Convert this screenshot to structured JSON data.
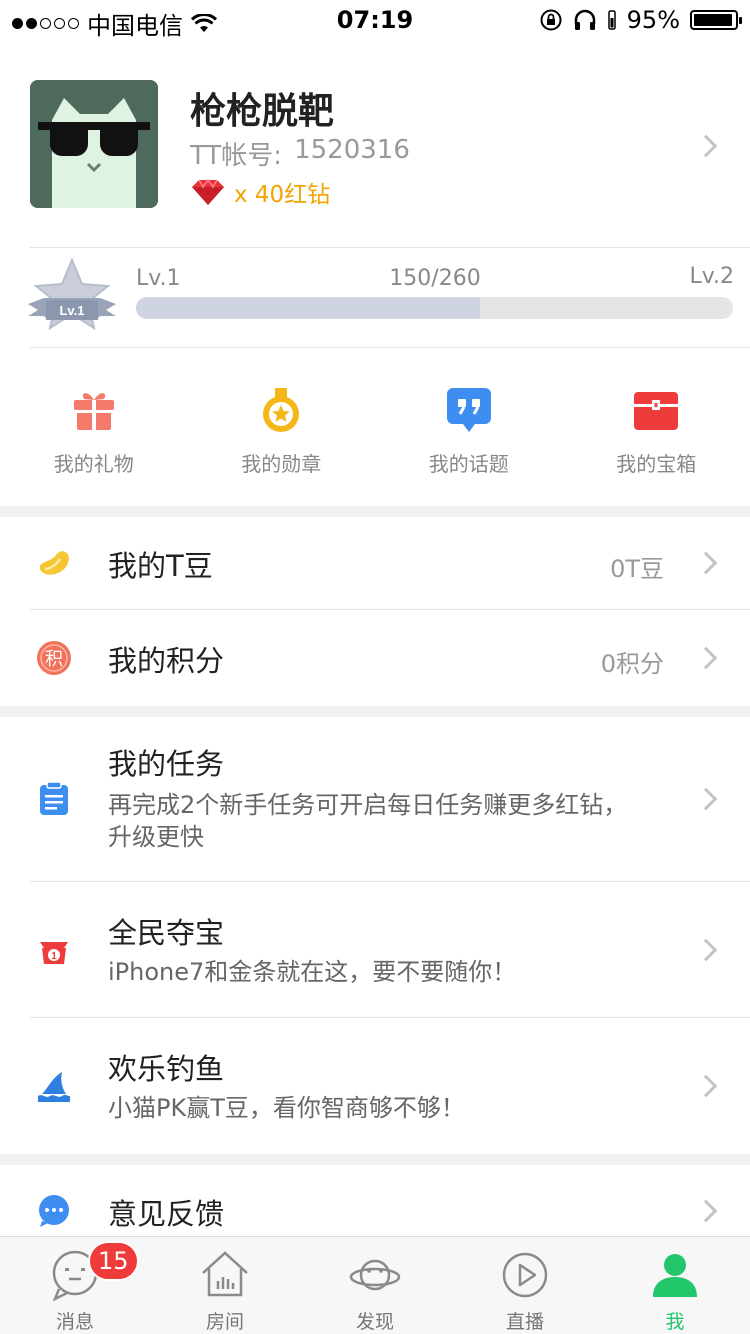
{
  "status_bar": {
    "carrier": "中国电信",
    "time": "07:19",
    "battery": "95%",
    "battery_level": 0.95
  },
  "profile": {
    "nickname": "枪枪脱靶",
    "account_label": "TT帐号:",
    "account_id": "1520316",
    "diamond_count": "x 40红钻"
  },
  "level": {
    "badge": "Lv.1",
    "current": "Lv.1",
    "next": "Lv.2",
    "progress_text": "150/260",
    "progress_fraction": 0.577
  },
  "quick_entries": [
    {
      "label": "我的礼物",
      "icon": "gift-icon"
    },
    {
      "label": "我的勋章",
      "icon": "medal-icon"
    },
    {
      "label": "我的话题",
      "icon": "topic-icon"
    },
    {
      "label": "我的宝箱",
      "icon": "treasure-box-icon"
    }
  ],
  "menu": {
    "tbean": {
      "title": "我的T豆",
      "value": "0T豆",
      "icon": "bean-icon"
    },
    "points": {
      "title": "我的积分",
      "value": "0积分",
      "icon": "points-icon",
      "icon_char": "积"
    },
    "tasks": {
      "title": "我的任务",
      "subtitle": "再完成2个新手任务可开启每日任务赚更多红钻，升级更快",
      "icon": "clipboard-icon"
    },
    "treasure": {
      "title": "全民夺宝",
      "subtitle": "iPhone7和金条就在这，要不要随你！",
      "icon": "lucky-bag-icon"
    },
    "fishing": {
      "title": "欢乐钓鱼",
      "subtitle": "小猫PK赢T豆，看你智商够不够！",
      "icon": "shark-fin-icon"
    },
    "feedback": {
      "title": "意见反馈",
      "icon": "chat-bubble-icon"
    }
  },
  "tabbar": {
    "tabs": [
      {
        "label": "消息",
        "icon": "message-icon",
        "badge": "15"
      },
      {
        "label": "房间",
        "icon": "room-icon"
      },
      {
        "label": "发现",
        "icon": "planet-icon"
      },
      {
        "label": "直播",
        "icon": "play-icon"
      },
      {
        "label": "我",
        "icon": "person-icon",
        "active": true
      }
    ]
  },
  "colors": {
    "accent_green": "#22c66b",
    "diamond_gold": "#f2a300",
    "badge_red": "#f03b3b"
  }
}
